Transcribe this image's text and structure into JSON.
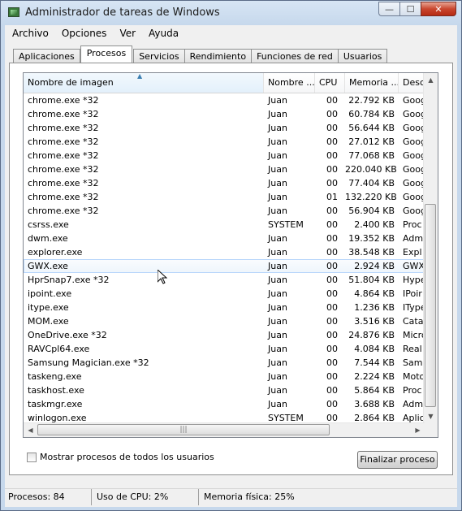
{
  "window": {
    "title": "Administrador de tareas de Windows",
    "minimize_glyph": "—",
    "maximize_glyph": "☐",
    "close_glyph": "✕"
  },
  "menu": [
    "Archivo",
    "Opciones",
    "Ver",
    "Ayuda"
  ],
  "tabs": [
    "Aplicaciones",
    "Procesos",
    "Servicios",
    "Rendimiento",
    "Funciones de red",
    "Usuarios"
  ],
  "active_tab": "Procesos",
  "table": {
    "columns": [
      "Nombre de imagen",
      "Nombre ...",
      "CPU",
      "Memoria ...",
      "Desc"
    ],
    "sorted_column": "Nombre de imagen",
    "rows": [
      {
        "name": "chrome.exe *32",
        "user": "Juan",
        "cpu": "00",
        "mem": "22.792 KB",
        "desc": "Goog"
      },
      {
        "name": "chrome.exe *32",
        "user": "Juan",
        "cpu": "00",
        "mem": "60.784 KB",
        "desc": "Goog"
      },
      {
        "name": "chrome.exe *32",
        "user": "Juan",
        "cpu": "00",
        "mem": "56.644 KB",
        "desc": "Goog"
      },
      {
        "name": "chrome.exe *32",
        "user": "Juan",
        "cpu": "00",
        "mem": "27.012 KB",
        "desc": "Goog"
      },
      {
        "name": "chrome.exe *32",
        "user": "Juan",
        "cpu": "00",
        "mem": "77.068 KB",
        "desc": "Goog"
      },
      {
        "name": "chrome.exe *32",
        "user": "Juan",
        "cpu": "00",
        "mem": "220.040 KB",
        "desc": "Goog"
      },
      {
        "name": "chrome.exe *32",
        "user": "Juan",
        "cpu": "00",
        "mem": "77.404 KB",
        "desc": "Goog"
      },
      {
        "name": "chrome.exe *32",
        "user": "Juan",
        "cpu": "01",
        "mem": "132.220 KB",
        "desc": "Goog"
      },
      {
        "name": "chrome.exe *32",
        "user": "Juan",
        "cpu": "00",
        "mem": "56.904 KB",
        "desc": "Goog"
      },
      {
        "name": "csrss.exe",
        "user": "SYSTEM",
        "cpu": "00",
        "mem": "2.400 KB",
        "desc": "Proc"
      },
      {
        "name": "dwm.exe",
        "user": "Juan",
        "cpu": "00",
        "mem": "19.352 KB",
        "desc": "Adm"
      },
      {
        "name": "explorer.exe",
        "user": "Juan",
        "cpu": "00",
        "mem": "38.548 KB",
        "desc": "Expl"
      },
      {
        "name": "GWX.exe",
        "user": "Juan",
        "cpu": "00",
        "mem": "2.924 KB",
        "desc": "GWX"
      },
      {
        "name": "HprSnap7.exe *32",
        "user": "Juan",
        "cpu": "00",
        "mem": "51.804 KB",
        "desc": "Hype"
      },
      {
        "name": "ipoint.exe",
        "user": "Juan",
        "cpu": "00",
        "mem": "4.864 KB",
        "desc": "IPoir"
      },
      {
        "name": "itype.exe",
        "user": "Juan",
        "cpu": "00",
        "mem": "1.236 KB",
        "desc": "IType"
      },
      {
        "name": "MOM.exe",
        "user": "Juan",
        "cpu": "00",
        "mem": "3.516 KB",
        "desc": "Cata"
      },
      {
        "name": "OneDrive.exe *32",
        "user": "Juan",
        "cpu": "00",
        "mem": "24.876 KB",
        "desc": "Micro"
      },
      {
        "name": "RAVCpl64.exe",
        "user": "Juan",
        "cpu": "00",
        "mem": "4.084 KB",
        "desc": "Real"
      },
      {
        "name": "Samsung Magician.exe *32",
        "user": "Juan",
        "cpu": "00",
        "mem": "7.544 KB",
        "desc": "Sam"
      },
      {
        "name": "taskeng.exe",
        "user": "Juan",
        "cpu": "00",
        "mem": "2.224 KB",
        "desc": "Moto"
      },
      {
        "name": "taskhost.exe",
        "user": "Juan",
        "cpu": "00",
        "mem": "5.864 KB",
        "desc": "Proc"
      },
      {
        "name": "taskmgr.exe",
        "user": "Juan",
        "cpu": "00",
        "mem": "3.688 KB",
        "desc": "Adm"
      },
      {
        "name": "winlogon.exe",
        "user": "SYSTEM",
        "cpu": "00",
        "mem": "2.864 KB",
        "desc": "Aplic"
      }
    ],
    "hovered_row": "GWX.exe"
  },
  "show_all_label": "Mostrar procesos de todos los usuarios",
  "show_all_checked": false,
  "end_process_label": "Finalizar proceso",
  "status": {
    "processes": "Procesos: 84",
    "cpu": "Uso de CPU: 2%",
    "memory": "Memoria física: 25%"
  }
}
